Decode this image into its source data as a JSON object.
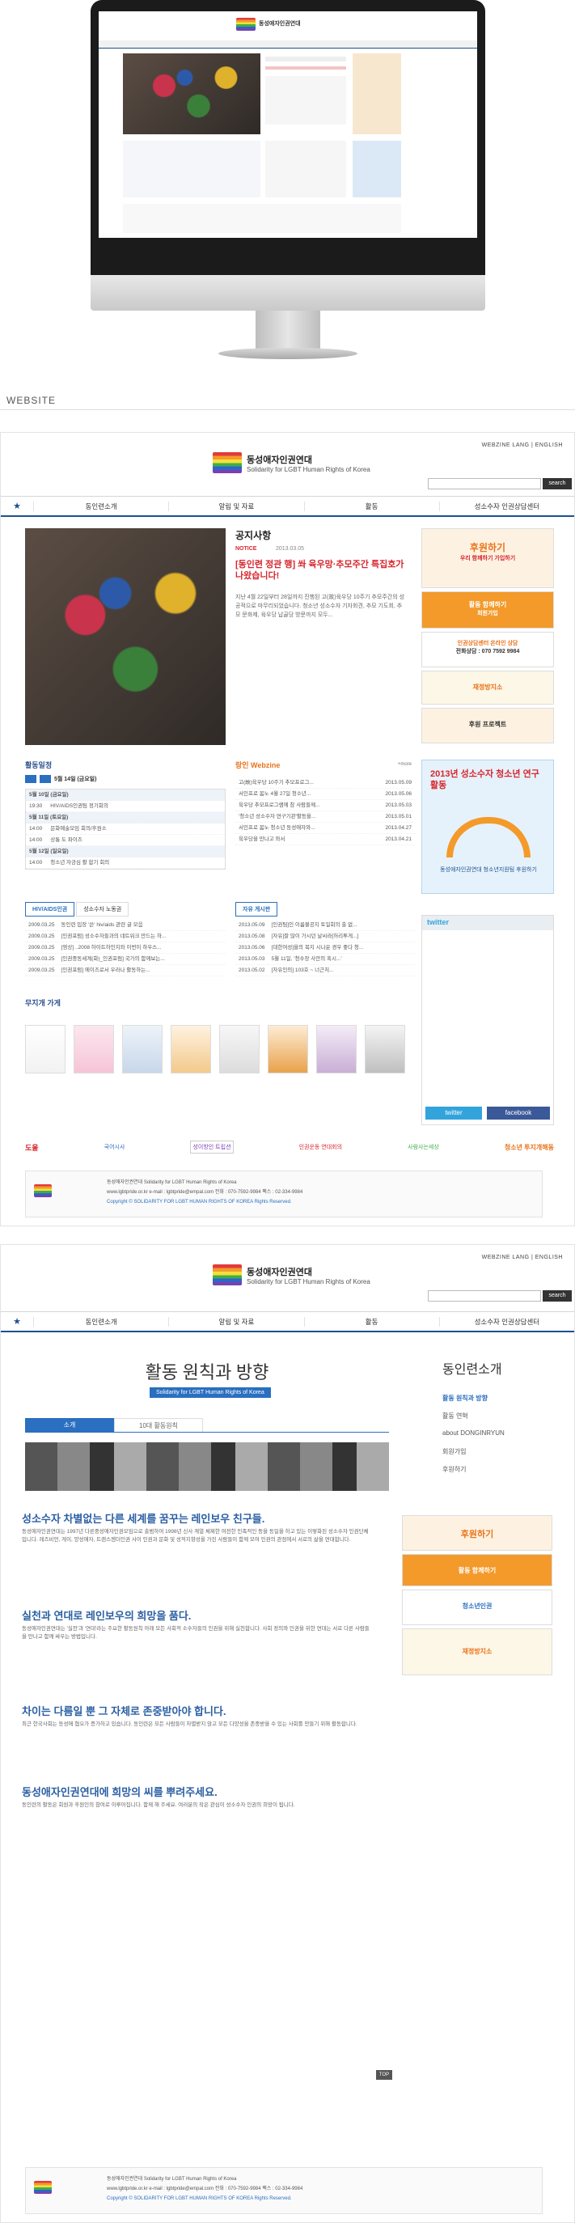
{
  "section_label": "WEBSITE",
  "colors": {
    "brand_blue": "#1e4f91",
    "accent_orange": "#e9731c",
    "highlight_red": "#d7262e"
  },
  "site": {
    "org_name": "동성애자인권연대",
    "org_sub": "Solidarity for LGBT Human Rights of Korea",
    "top_links": "WEBZINE LANG  |  ENGLISH",
    "search_label": "search",
    "nav": [
      "동인련소개",
      "알림 및 자료",
      "활동",
      "성소수자 인권상담센터"
    ]
  },
  "home": {
    "notice_title": "공지사항",
    "notice_badge": "NOTICE",
    "notice_date": "2013.03.05",
    "notice_headline": "[동인련 정관 행] 쏴 육우망·추모주간 특집호가 나왔습니다!",
    "notice_body": "지난 4월 22일부터 28일까지 진행된 고(故)육우당 10주기 추모주간의 성공적으로 마무리되었습니다. 청소년 성소수자 기자회견, 추모 기도회, 추모 문화제, 육우당 납골당 방문까지 모두...",
    "donate_title": "후원하기",
    "donate_sub": "우리 함께하기 가입하기",
    "join_label": "활동 함께하기",
    "join_sub": "회원가입",
    "counsel_label": "인권상담센터 온라인 상담",
    "counsel_phone": "전화상담 : 070 7592 9984",
    "youth_label": "재정방지소",
    "project_label": "후원 프로젝트",
    "schedule_title": "활동일정",
    "schedule_date": "5월 14일 (금요일)",
    "schedule": [
      {
        "day": "5월 10일 (금요일)",
        "items": [
          {
            "time": "19:30",
            "text": "HIV/AIDS인권팀 정기회의"
          }
        ]
      },
      {
        "day": "5월 11일 (토요일)",
        "items": [
          {
            "time": "14:00",
            "text": "문화예술모임 회의/후원소"
          },
          {
            "time": "14:00",
            "text": "상통 도 파이즈"
          }
        ]
      },
      {
        "day": "5월 12일 (일요일)",
        "items": [
          {
            "time": "14:00",
            "text": "청소년 자긍심 활 합기 회의"
          }
        ]
      }
    ],
    "webzine_title": "랑인 Webzine",
    "webzine": [
      {
        "t": "고(故)육우당 10주기 추모프로그...",
        "d": "2013.05.09"
      },
      {
        "t": "서인프로 봄노 4월 27일 청소년...",
        "d": "2013.05.06"
      },
      {
        "t": "육우당 추모프로그램에 참 사람들께...",
        "d": "2013.05.03"
      },
      {
        "t": "'청소년 성소수자 연구기관'활동을...",
        "d": "2013.05.01"
      },
      {
        "t": "서인프로 봄노 청소년 동성애자와...",
        "d": "2013.04.27"
      },
      {
        "t": "육우당을 만나고 와서",
        "d": "2013.04.21"
      }
    ],
    "poster_title": "2013년 성소수자 청소년 연구활동",
    "poster_caption": "동성애자인권연대 청소년지원팀 후원하기",
    "tabs": [
      "HIV/AIDS인권",
      "성소수자 노동권"
    ],
    "tab_rows": [
      {
        "d": "2009.03.25",
        "t": "동인련 입장 '쓴' hiv/aids 관련 글 모음"
      },
      {
        "d": "2009.03.25",
        "t": "[인권포럼] 성소수자들과의 네트워크 만드는 하..."
      },
      {
        "d": "2009.03.25",
        "t": "[영상] ..2008 하이트하인지와 이번이 하우스..."
      },
      {
        "d": "2009.03.25",
        "t": "[인권중동세계(화)_인권포럼] 국가의 함께보는..."
      },
      {
        "d": "2009.03.25",
        "t": "[인권포럼] 에이즈로서 우라나 활동하는..."
      }
    ],
    "free_title": "자유 게시판",
    "free_rows": [
      {
        "d": "2013.05.09",
        "t": "[인권팀]인 이름불공지 토일회의 출 없..."
      },
      {
        "d": "2013.05.08",
        "t": "[자유]잘 많이 가시던 날씨라[허리투게...]"
      },
      {
        "d": "2013.05.06",
        "t": "[대한여성]을의 복지 시나운 경우 좋다 청..."
      },
      {
        "d": "2013.05.03",
        "t": "5월 11일, '청수장 사안의 혹시...'"
      },
      {
        "d": "2013.05.02",
        "t": "[자유인의] 103호 ~ 너근처..."
      }
    ],
    "shop_title": "무지개 가게",
    "twitter_label": "twitter",
    "facebook_label": "facebook",
    "partners": [
      "도울",
      "국어시사",
      "성이방인 트립션",
      "인권운동 연대회의",
      "사람사는세상",
      "청소년 투지개해동"
    ]
  },
  "sub": {
    "page_title": "활동 원칙과 방향",
    "page_sub": "Solidarity for LGBT Human Rights of Korea",
    "tabs": [
      "소개",
      "10대 활동원칙"
    ],
    "sections": [
      {
        "h": "성소수자 차별없는 다른 세계를 꿈꾸는 레인보우 친구들.",
        "p": "동성애자인권연대는 1997년 다른중성애자인권모임으로 출범하여 1998년 신사 계열 체제한 여전한 민족적인 등을 동일을 하고 있는 이렇화된 성소수자 인권단체입니다. 레즈비언, 게이, 양성애자, 트랜스젠더인권 사이 인권과 문화 및 성적지향성을 가진 사람들이 함께 모여 인권의 관점에서 서로의 삶을 연대합니다."
      },
      {
        "h": "실천과 연대로 레인보우의 희망을 품다.",
        "p": "동성애자인권연대는 '실천'과 '연대'라는 주요한 활동원칙 아래 모든 사회적 소수자들의 인권을 위해 실천합니다. 사회 정의와 인권을 위한 연대는 서로 다른 사람들을 만나고 함께 싸우는 방법입니다."
      },
      {
        "h": "차이는 다름일 뿐 그 자체로 존중받아야 합니다.",
        "p": "최근 한국사회는 동성애 혐오가 증가하고 있습니다. 동인련은 모든 사람들이 차별받지 않고 모든 다양성을 존중받을 수 있는 사회를 만들기 위해 활동합니다."
      },
      {
        "h": "동성애자인권연대에 희망의 씨를 뿌려주세요.",
        "p": "동인련의 활동은 회원과 후원인의 참여로 이루어집니다. 함께 해 주세요. 여러분의 작은 관심이 성소수자 인권의 희망이 됩니다."
      }
    ],
    "top_button": "TOP",
    "side_title": "동인련소개",
    "side_items": [
      "활동 원칙과 방향",
      "활동 연혁",
      "about DONGINRYUN",
      "회원가입",
      "후원하기"
    ],
    "side_banner1": "후원하기",
    "side_banner2": "활동 함께하기",
    "side_banner3": "청소년인권",
    "side_banner4": "재정방지소"
  },
  "footer": {
    "line1": "동성애자인권연대 Solidarity for LGBT Human Rights of Korea",
    "line2": "www.lgbtpride.or.kr e-mail : lgbtpride@empal.com 전화 : 070-7592-9984 팩스 : 02-334-9984",
    "line3": "Copyright © SOLIDARITY FOR LGBT HUMAN RIGHTS OF KOREA Rights Reserved."
  }
}
